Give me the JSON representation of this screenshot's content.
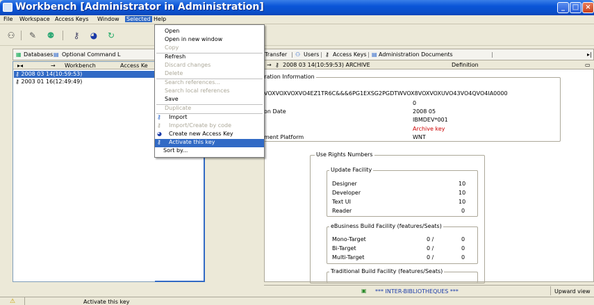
{
  "window": {
    "title": "Workbench [Administrator in Administration]"
  },
  "menubar": [
    "File",
    "Workspace",
    "Access Keys",
    "Window",
    "Selected",
    "Help"
  ],
  "left_panel": {
    "tabs": [
      "Databases",
      "Optional Command L"
    ],
    "columns": [
      "Workbench",
      "Access Ke"
    ],
    "rows": [
      "2008 03 14(10:59:53)",
      "2003 01 16(12:49:49)"
    ]
  },
  "dropdown": {
    "items": [
      {
        "label": "Open",
        "enabled": true
      },
      {
        "label": "Open in new window",
        "enabled": true
      },
      {
        "label": "Copy",
        "enabled": false
      },
      {
        "label": "Refresh",
        "enabled": true
      },
      {
        "label": "Discard changes",
        "enabled": false
      },
      {
        "label": "Delete",
        "enabled": false
      },
      {
        "label": "Search references...",
        "enabled": false
      },
      {
        "label": "Search local references",
        "enabled": false
      },
      {
        "label": "Save",
        "enabled": true
      },
      {
        "label": "Duplicate",
        "enabled": false
      },
      {
        "label": "Import",
        "enabled": true
      },
      {
        "label": "Import/Create by code",
        "enabled": false
      },
      {
        "label": "Create new Access Key",
        "enabled": true
      },
      {
        "label": "Activate this key",
        "enabled": true
      },
      {
        "label": "Sort by...",
        "enabled": true
      }
    ]
  },
  "right_panel": {
    "tabs": [
      "Transfer",
      "Users",
      "Access Keys",
      "Administration Documents"
    ],
    "header": {
      "breadcrumb": "2008 03 14(10:59:53) ARCHIVE",
      "definition": "Definition"
    },
    "registration": {
      "title": "stration Information",
      "code": "VOXVOXVOXVO4EZ1TR6C&&&6PG1EXSG2PGDTWVOX8VOXVOXUVO43VO4QVO4IA0000",
      "value_zero": "0",
      "date_label": "on Date",
      "date_value": "2008 05",
      "device": "IBMDEV*001",
      "archive": "Archive key",
      "platform_label": "ment Platform",
      "platform_value": "WNT"
    },
    "use_rights": {
      "title": "Use Rights Numbers",
      "update_facility": {
        "title": "Update Facility",
        "rows": [
          {
            "label": "Designer",
            "value": "10"
          },
          {
            "label": "Developer",
            "value": "10"
          },
          {
            "label": "Text UI",
            "value": "10"
          },
          {
            "label": "Reader",
            "value": "0"
          }
        ]
      },
      "ebusiness": {
        "title": "eBusiness Build Facility (features/Seats)",
        "rows": [
          {
            "label": "Mono-Target",
            "a": "0 /",
            "b": "0"
          },
          {
            "label": "Bi-Target",
            "a": "0 /",
            "b": "0"
          },
          {
            "label": "Multi-Target",
            "a": "0 /",
            "b": "0"
          }
        ]
      },
      "traditional": {
        "title": "Traditional Build Facility (features/Seats)"
      }
    }
  },
  "bottom": {
    "library": "*** INTER-BIBLIOTHEQUES ***",
    "view": "Upward view"
  },
  "status": {
    "text": "Activate this key"
  },
  "colors": {
    "selection": "#316ac5",
    "archive_red": "#cc0000",
    "titlebar": "#0a55d8"
  }
}
